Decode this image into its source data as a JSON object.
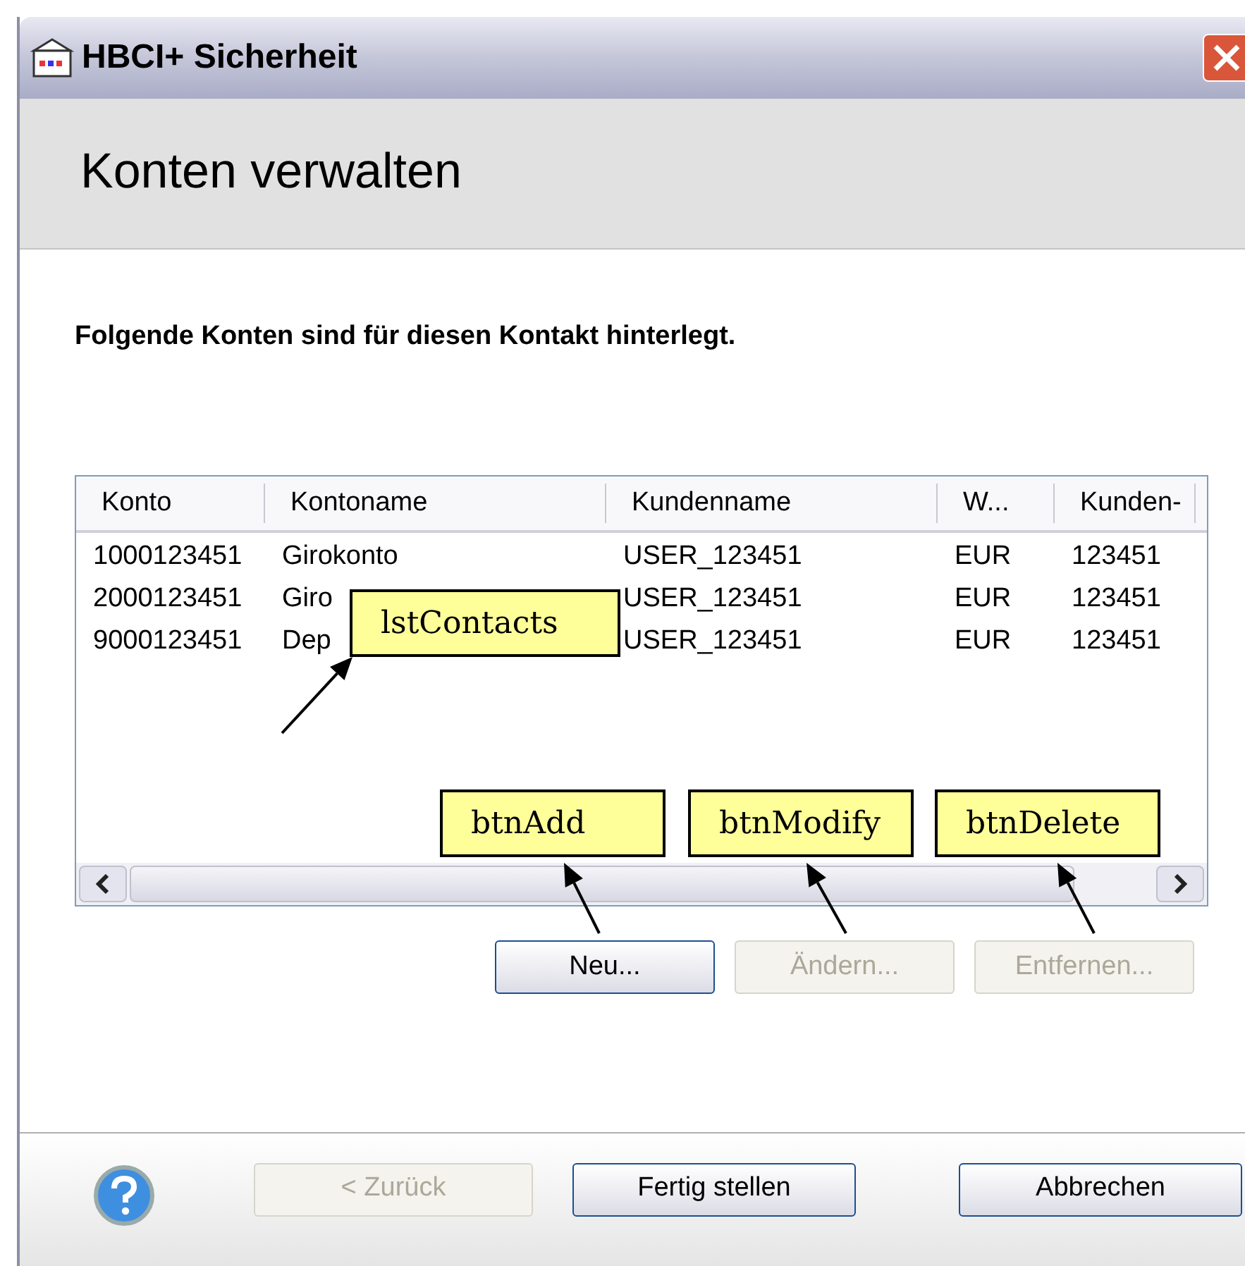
{
  "window": {
    "title": "HBCI+ Sicherheit"
  },
  "header": {
    "title": "Konten verwalten"
  },
  "description": "Folgende Konten sind für diesen Kontakt hinterlegt.",
  "list": {
    "columns": [
      "Konto",
      "Kontoname",
      "Kundenname",
      "W...",
      "Kunden-"
    ],
    "rows": [
      [
        "1000123451",
        "Girokonto",
        "USER_123451",
        "EUR",
        "123451"
      ],
      [
        "2000123451",
        "Giro",
        "USER_123451",
        "EUR",
        "123451"
      ],
      [
        "9000123451",
        "Dep",
        "USER_123451",
        "EUR",
        "123451"
      ]
    ]
  },
  "list_buttons": [
    {
      "label": "Neu...",
      "disabled": false
    },
    {
      "label": "Ändern...",
      "disabled": true
    },
    {
      "label": "Entfernen...",
      "disabled": true
    }
  ],
  "footer_buttons": [
    {
      "label": "< Zurück",
      "disabled": true
    },
    {
      "label": "Fertig stellen",
      "disabled": false
    },
    {
      "label": "Abbrechen",
      "disabled": false
    }
  ],
  "callouts": [
    "lstContacts",
    "btnAdd",
    "btnModify",
    "btnDelete"
  ]
}
